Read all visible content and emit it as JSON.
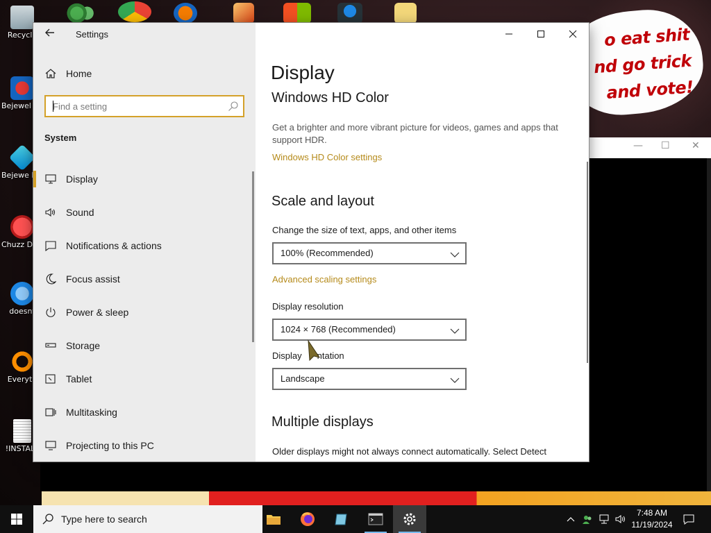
{
  "desktop": {
    "bubble_text_line1": "o eat shit",
    "bubble_text_line2": "nd go trick",
    "bubble_text_line3": "and vote!",
    "icons": [
      {
        "label": "Recycle"
      },
      {
        "label": "Bejewel Delux"
      },
      {
        "label": "Bejewe Delux"
      },
      {
        "label": "Chuzz Delux"
      },
      {
        "label": "doesnt"
      },
      {
        "label": "Everyth"
      },
      {
        "label": "!INSTALL"
      }
    ]
  },
  "window": {
    "title": "Settings",
    "minimize_label": "Minimize",
    "maximize_label": "Maximize",
    "close_label": "Close"
  },
  "nav": {
    "home_label": "Home",
    "search_placeholder": "Find a setting",
    "section_heading": "System",
    "items": [
      {
        "label": "Display",
        "icon": "monitor-icon",
        "active": true
      },
      {
        "label": "Sound",
        "icon": "speaker-icon"
      },
      {
        "label": "Notifications & actions",
        "icon": "message-icon"
      },
      {
        "label": "Focus assist",
        "icon": "moon-icon"
      },
      {
        "label": "Power & sleep",
        "icon": "power-icon"
      },
      {
        "label": "Storage",
        "icon": "storage-icon"
      },
      {
        "label": "Tablet",
        "icon": "tablet-icon"
      },
      {
        "label": "Multitasking",
        "icon": "multitasking-icon"
      },
      {
        "label": "Projecting to this PC",
        "icon": "projector-icon"
      }
    ]
  },
  "content": {
    "page_title": "Display",
    "hdr_heading": "Windows HD Color",
    "hdr_desc": "Get a brighter and more vibrant picture for videos, games and apps that support HDR.",
    "hdr_link": "Windows HD Color settings",
    "scale_heading": "Scale and layout",
    "scale_label": "Change the size of text, apps, and other items",
    "scale_value": "100% (Recommended)",
    "advanced_link": "Advanced scaling settings",
    "resolution_label": "Display resolution",
    "resolution_value": "1024 × 768 (Recommended)",
    "orientation_label": "Display orientation",
    "orientation_label_visible": "Display",
    "orientation_label_tail": "ntation",
    "orientation_value": "Landscape",
    "multi_heading": "Multiple displays",
    "multi_desc": "Older displays might not always connect automatically. Select Detect"
  },
  "taskbar": {
    "search_placeholder": "Type here to search",
    "time": "7:48 AM",
    "date": "11/19/2024",
    "accent_color": "#76b9ed"
  },
  "colors": {
    "accent": "#d4a129",
    "link": "#b58a1a"
  }
}
